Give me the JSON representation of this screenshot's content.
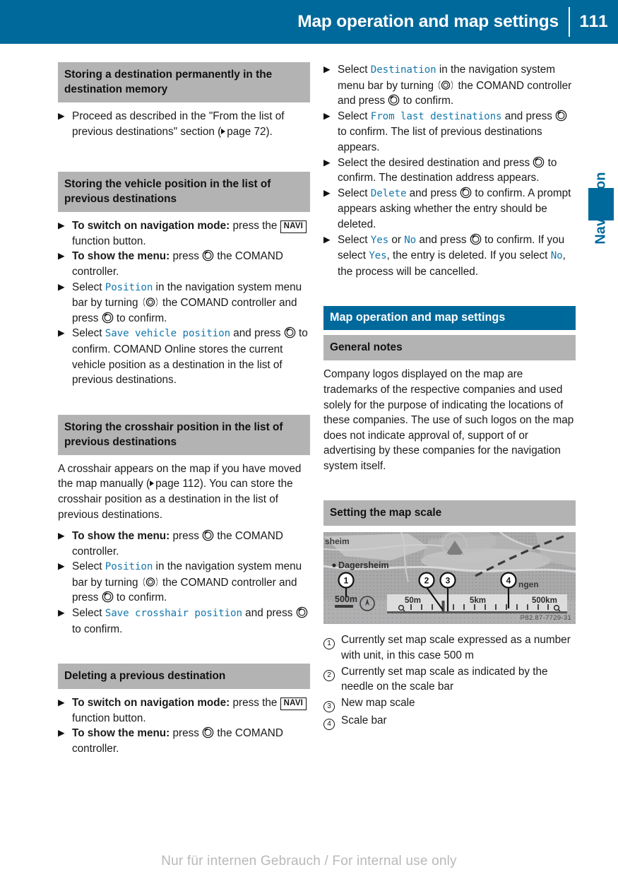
{
  "header": {
    "title": "Map operation and map settings",
    "page_number": "111"
  },
  "side_tab": {
    "label": "Navigation"
  },
  "icons": {
    "navi_button": "NAVI",
    "turn_controller": "turn-comand-controller-icon",
    "press_controller": "press-comand-controller-icon",
    "xref": "cross-reference-arrow-icon",
    "bullet": "step-bullet-icon"
  },
  "left_column": {
    "section1": {
      "heading": "Storing a destination permanently in the destination memory",
      "steps": [
        {
          "text_before": "Proceed as described in the \"From the list of previous destinations\" section (",
          "xref_label": "page 72",
          "text_after": ")."
        }
      ]
    },
    "section2": {
      "heading": "Storing the vehicle position in the list of previous destinations",
      "steps": [
        {
          "lead": "To switch on navigation mode:",
          "rest": " press the",
          "btn": "NAVI",
          "tail": " function button."
        },
        {
          "lead": "To show the menu:",
          "rest": " press",
          "tail": " the COMAND controller."
        },
        {
          "pre": "Select ",
          "mono": "Position",
          "mid": " in the navigation system menu bar by turning",
          "mid2": " the COMAND controller and press",
          "tail": " to confirm."
        },
        {
          "pre": "Select ",
          "mono": "Save vehicle position",
          "mid": " and press",
          "tail": " to confirm.",
          "result": "COMAND Online stores the current vehicle position as a destination in the list of previous destinations."
        }
      ]
    },
    "section3": {
      "heading": "Storing the crosshair position in the list of previous destinations",
      "intro_before": "A crosshair appears on the map if you have moved the map manually (",
      "intro_xref": "page 112",
      "intro_after": "). You can store the crosshair position as a destination in the list of previous destinations.",
      "steps": [
        {
          "lead": "To show the menu:",
          "rest": " press",
          "tail": " the COMAND controller."
        },
        {
          "pre": "Select ",
          "mono": "Position",
          "mid": " in the navigation system menu bar by turning",
          "mid2": " the COMAND controller and press",
          "tail": " to confirm."
        },
        {
          "pre": "Select ",
          "mono": "Save crosshair position",
          "mid": " and press",
          "tail": " to confirm."
        }
      ]
    },
    "section4": {
      "heading": "Deleting a previous destination",
      "steps": [
        {
          "lead": "To switch on navigation mode:",
          "rest": " press the",
          "btn": "NAVI",
          "tail": " function button."
        },
        {
          "lead": "To show the menu:",
          "rest": " press",
          "tail": " the COMAND controller."
        }
      ]
    }
  },
  "right_column": {
    "continued_steps": [
      {
        "pre": "Select ",
        "mono": "Destination",
        "mid": " in the navigation system menu bar by turning",
        "mid2": " the COMAND controller and press",
        "tail": " to confirm."
      },
      {
        "pre": "Select ",
        "mono": "From last destinations",
        "mid": " and press",
        "tail": " to confirm.",
        "result": "The list of previous destinations appears."
      },
      {
        "pre": "Select the desired destination and press",
        "tail": " to confirm.",
        "result": "The destination address appears."
      },
      {
        "pre": "Select ",
        "mono": "Delete",
        "mid": " and press",
        "tail": " to confirm.",
        "result": "A prompt appears asking whether the entry should be deleted."
      },
      {
        "pre": "Select ",
        "mono": "Yes",
        "mid_plain": " or ",
        "mono2": "No",
        "mid": " and press",
        "tail": " to confirm.",
        "result_a_pre": "If you select ",
        "result_a_mono": "Yes",
        "result_a_post": ", the entry is deleted.",
        "result_b_pre": "If you select ",
        "result_b_mono": "No",
        "result_b_post": ", the process will be cancelled."
      }
    ],
    "section_map": {
      "heading": "Map operation and map settings",
      "subheading_general": "General notes",
      "general_text": "Company logos displayed on the map are trademarks of the respective companies and used solely for the purpose of indicating the locations of these companies. The use of such logos on the map does not indicate approval of, support of or advertising by these companies for the navigation system itself.",
      "subheading_scale": "Setting the map scale"
    },
    "figure": {
      "caption_code": "P82.87-7729-31",
      "map_labels": {
        "town_partial": "sheim",
        "town_main": "Dagersheim",
        "town_right": "ngen",
        "current_scale": "500m",
        "scale_min": "50m",
        "scale_mid": "5km",
        "scale_max": "500km"
      },
      "callouts": [
        "1",
        "2",
        "3",
        "4"
      ]
    },
    "legend": [
      {
        "num": "1",
        "text": "Currently set map scale expressed as a number with unit, in this case 500 m"
      },
      {
        "num": "2",
        "text": "Currently set map scale as indicated by the needle on the scale bar"
      },
      {
        "num": "3",
        "text": "New map scale"
      },
      {
        "num": "4",
        "text": "Scale bar"
      }
    ]
  },
  "footer": {
    "watermark": "Nur für internen Gebrauch / For internal use only"
  },
  "colors": {
    "brand_blue": "#00699b",
    "heading_gray": "#b3b3b3",
    "mono_blue": "#1577ad"
  }
}
